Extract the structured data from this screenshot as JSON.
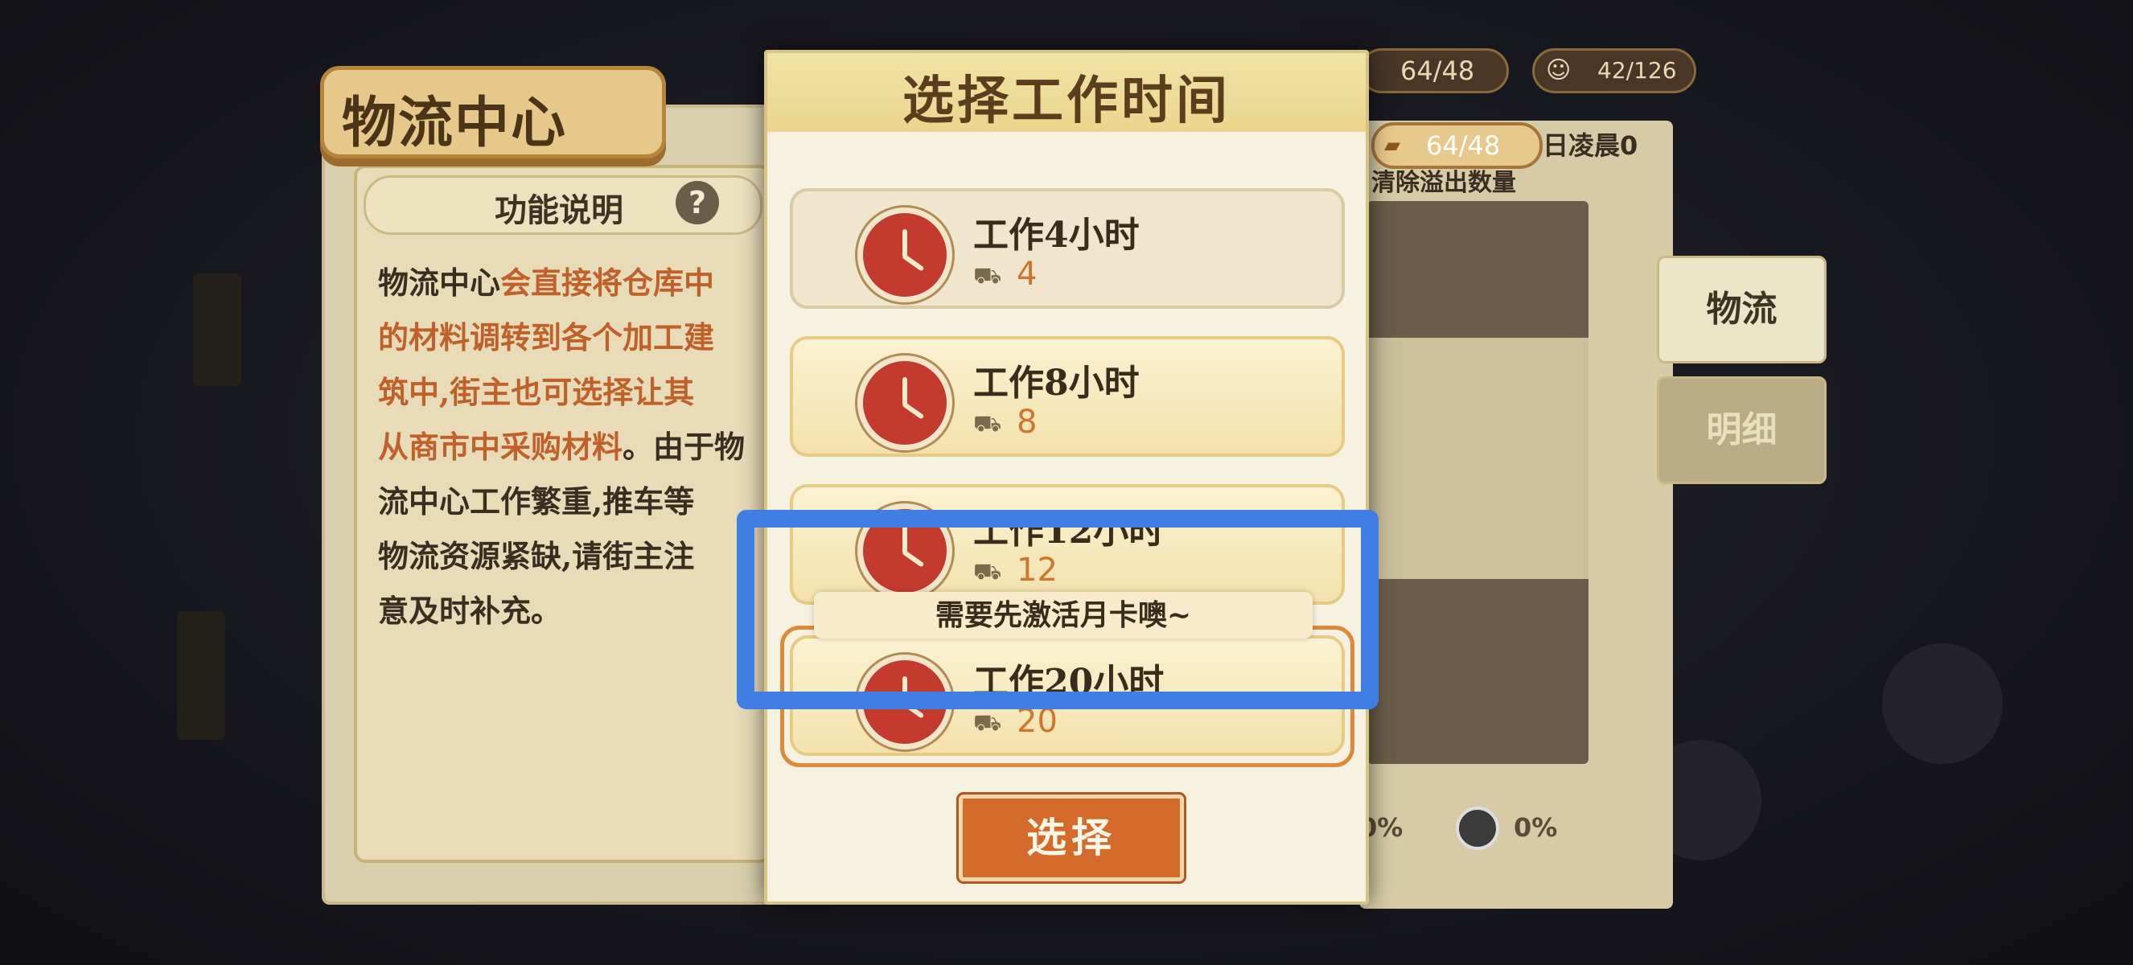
{
  "panel": {
    "title": "物流中心",
    "func_header": "功能说明",
    "help_symbol": "?",
    "description_lines": [
      {
        "parts": [
          {
            "text": "物流中心",
            "hl": false
          },
          {
            "text": "会直接将仓库中",
            "hl": true
          }
        ]
      },
      {
        "parts": [
          {
            "text": "的材料调转到各个加工建",
            "hl": true
          }
        ]
      },
      {
        "parts": [
          {
            "text": "筑中,街主也可选择让其",
            "hl": true
          }
        ]
      },
      {
        "parts": [
          {
            "text": "从商市中采购材料",
            "hl": true
          },
          {
            "text": "。由于物",
            "hl": false
          }
        ]
      },
      {
        "parts": [
          {
            "text": "流中心工作繁重,推车等",
            "hl": false
          }
        ]
      },
      {
        "parts": [
          {
            "text": "物流资源紧缺,请街主注",
            "hl": false
          }
        ]
      },
      {
        "parts": [
          {
            "text": "意及时补充。",
            "hl": false
          }
        ]
      }
    ]
  },
  "top_bar": {
    "cart_count": "64/48",
    "worker_count": "42/126"
  },
  "right": {
    "cart_pill": "64/48",
    "reset_text": "日凌晨0",
    "overflow_text": "清除溢出数量",
    "tabs": [
      "物流",
      "明细"
    ],
    "pct_left": "0%",
    "pct_right": "0%"
  },
  "modal": {
    "title": "选择工作时间",
    "options": [
      {
        "label": "工作4小时",
        "cost": "4"
      },
      {
        "label": "工作8小时",
        "cost": "8"
      },
      {
        "label": "工作12小时",
        "cost": "12"
      },
      {
        "label": "工作20小时",
        "cost": "20"
      }
    ],
    "toast": "需要先激活月卡噢~",
    "select_button": "选择"
  },
  "colors": {
    "highlight": "#3f7ee3",
    "accent_orange": "#d46b2c",
    "text_dark": "#3a2c1b"
  }
}
